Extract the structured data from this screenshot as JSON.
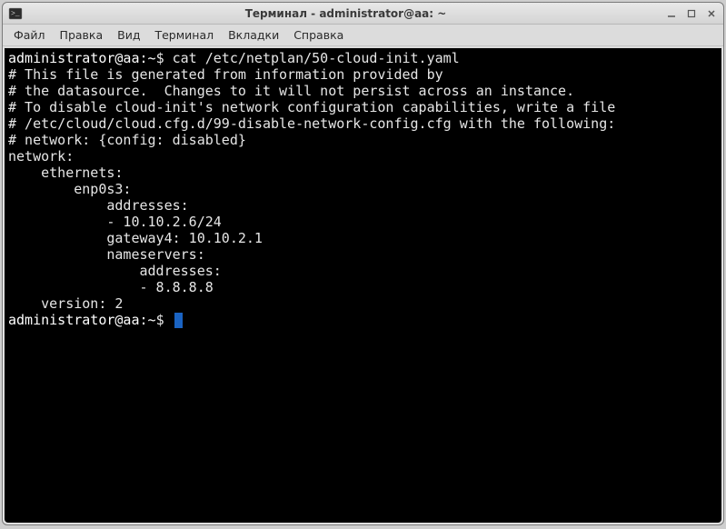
{
  "window": {
    "title": "Терминал - administrator@aa: ~"
  },
  "menubar": {
    "items": [
      "Файл",
      "Правка",
      "Вид",
      "Терминал",
      "Вкладки",
      "Справка"
    ]
  },
  "terminal": {
    "prompt1": {
      "userhost": "administrator@aa",
      "path": "~",
      "sep": ":",
      "dollar": "$",
      "command": "cat /etc/netplan/50-cloud-init.yaml"
    },
    "output_lines": [
      "# This file is generated from information provided by",
      "# the datasource.  Changes to it will not persist across an instance.",
      "# To disable cloud-init's network configuration capabilities, write a file",
      "# /etc/cloud/cloud.cfg.d/99-disable-network-config.cfg with the following:",
      "# network: {config: disabled}",
      "network:",
      "    ethernets:",
      "        enp0s3:",
      "            addresses:",
      "            - 10.10.2.6/24",
      "            gateway4: 10.10.2.1",
      "            nameservers:",
      "                addresses:",
      "                - 8.8.8.8",
      "    version: 2"
    ],
    "prompt2": {
      "userhost": "administrator@aa",
      "path": "~",
      "sep": ":",
      "dollar": "$"
    }
  }
}
